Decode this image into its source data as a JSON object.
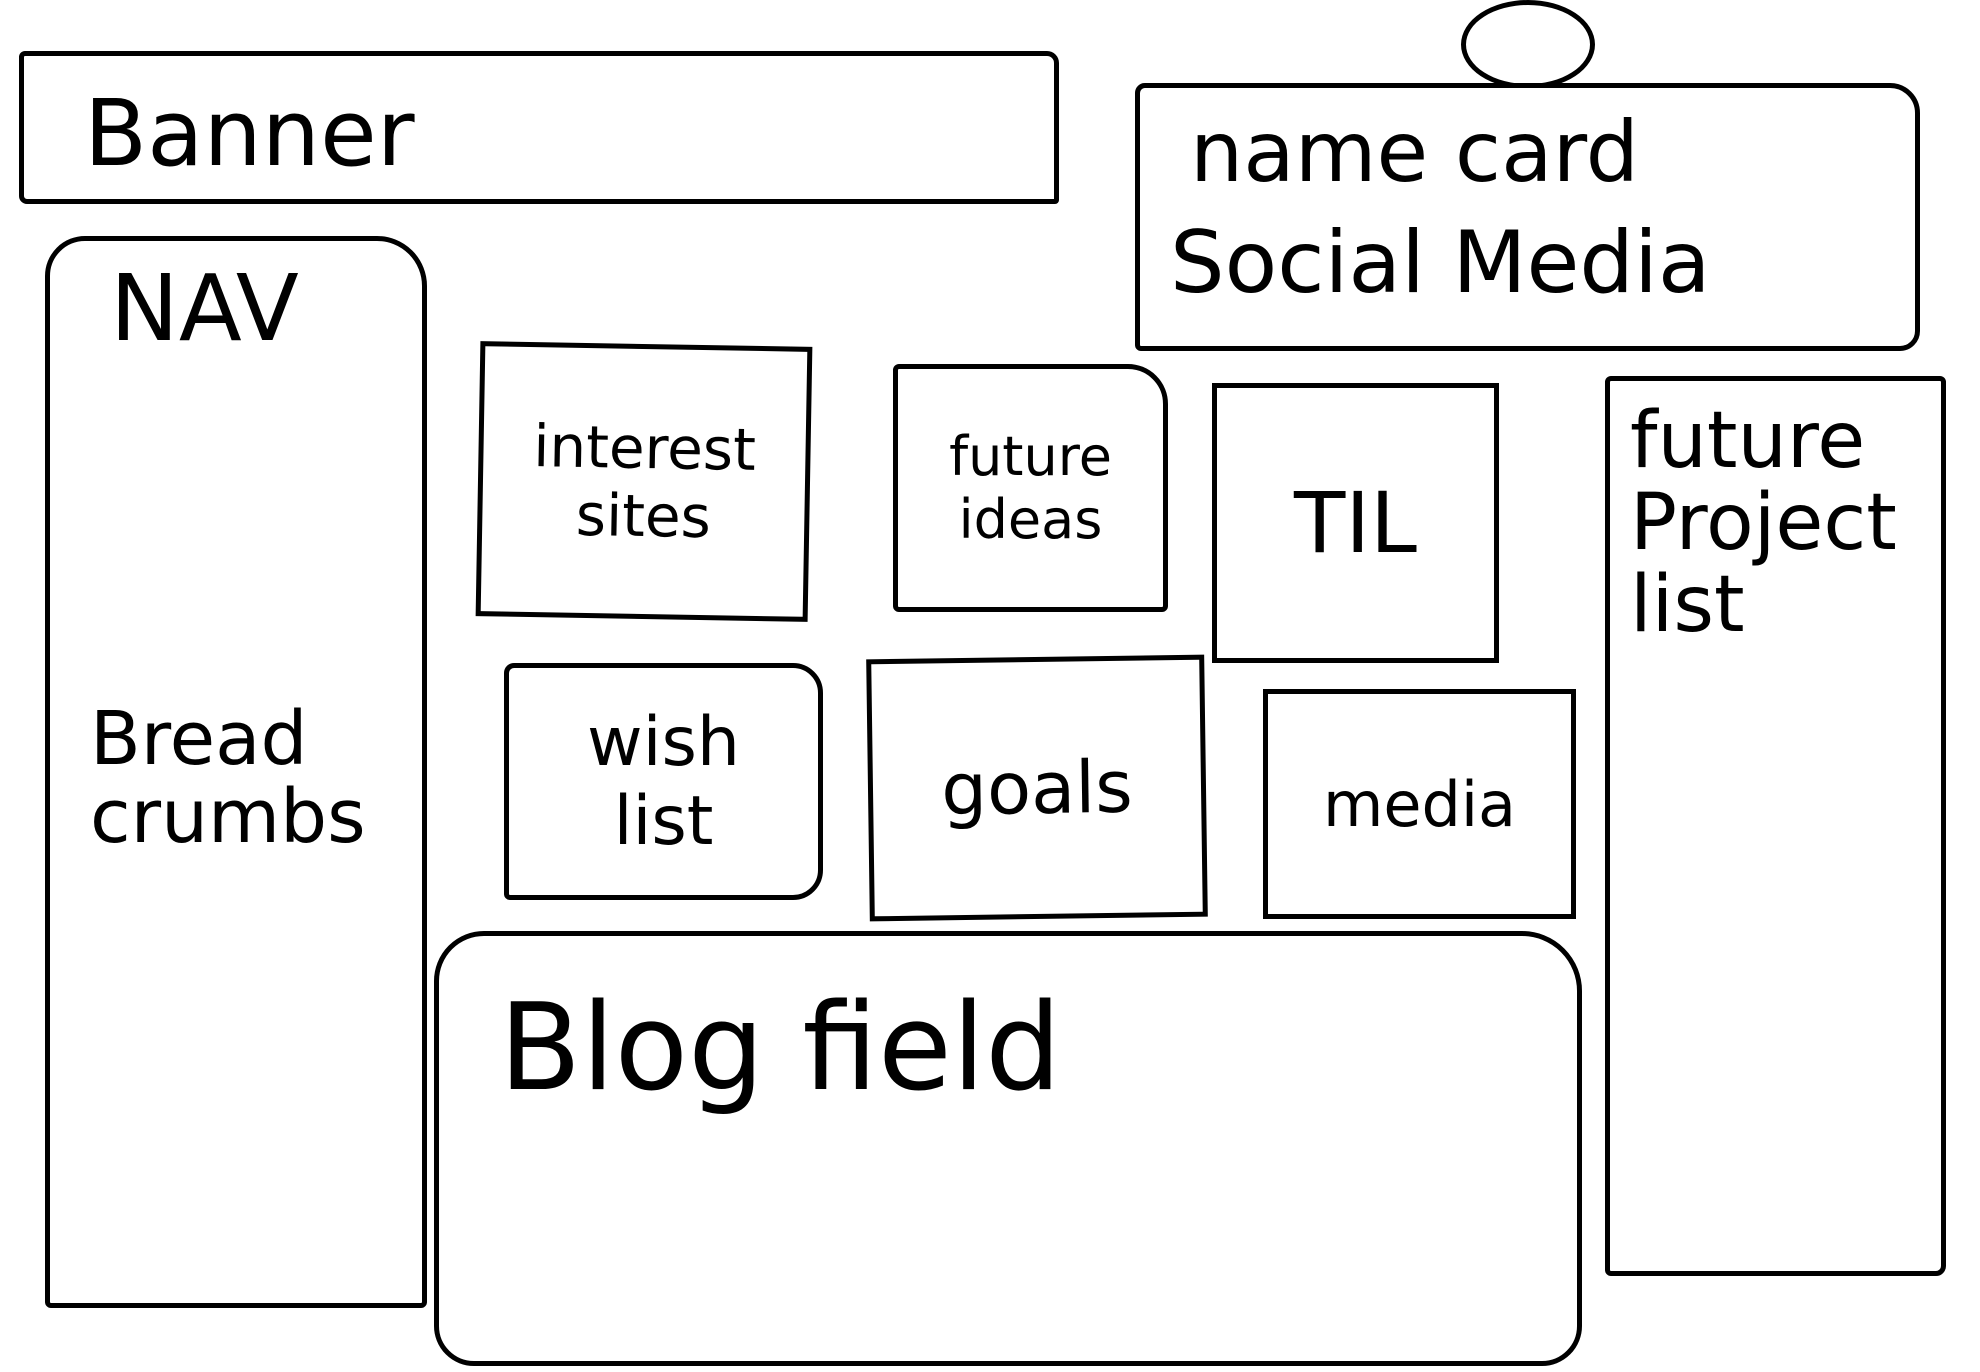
{
  "banner": {
    "label": "Banner"
  },
  "name_card": {
    "title": "name card",
    "subtitle": "Social Media",
    "avatar_icon": "avatar-circle-icon"
  },
  "nav": {
    "title": "NAV",
    "breadcrumbs": "Bread crumbs"
  },
  "tiles": [
    {
      "label": "interest sites"
    },
    {
      "label": "future ideas"
    },
    {
      "label": "TIL"
    },
    {
      "label": "wish list"
    },
    {
      "label": "goals"
    },
    {
      "label": "media"
    }
  ],
  "future_projects": {
    "label": "future Project list"
  },
  "blog": {
    "label": "Blog field"
  }
}
